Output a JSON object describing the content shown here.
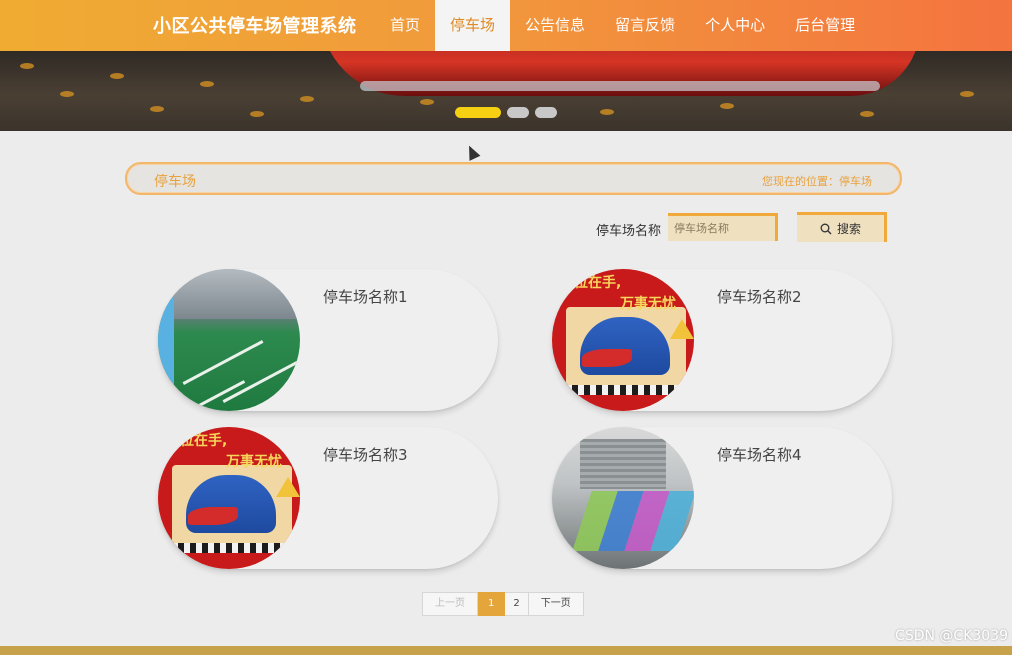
{
  "header": {
    "site_title": "小区公共停车场管理系统",
    "nav": [
      {
        "label": "首页",
        "active": false
      },
      {
        "label": "停车场",
        "active": true
      },
      {
        "label": "公告信息",
        "active": false
      },
      {
        "label": "留言反馈",
        "active": false
      },
      {
        "label": "个人中心",
        "active": false
      },
      {
        "label": "后台管理",
        "active": false
      }
    ]
  },
  "banner": {
    "slide_count": 3,
    "active_slide": 1
  },
  "breadcrumb": {
    "title": "停车场",
    "location": "您现在的位置：停车场"
  },
  "search": {
    "label": "停车场名称",
    "placeholder": "停车场名称",
    "button_label": "搜索"
  },
  "lots": [
    {
      "name": "停车场名称1",
      "image": "garage-photo"
    },
    {
      "name": "停车场名称2",
      "image": "promo-car-photo"
    },
    {
      "name": "停车场名称3",
      "image": "promo-car-photo"
    },
    {
      "name": "停车场名称4",
      "image": "colored-bays-photo"
    }
  ],
  "promo_image": {
    "slogan_line1": "车位在手,",
    "slogan_line2": "万事无忧"
  },
  "pagination": {
    "prev": "上一页",
    "pages": [
      "1",
      "2"
    ],
    "current": "1",
    "next": "下一页"
  },
  "watermark": "CSDN @CK3039",
  "colors": {
    "header_start": "#f0ac32",
    "header_end": "#f4733f",
    "accent": "#e4a63a",
    "slider_active": "#f5d013"
  }
}
